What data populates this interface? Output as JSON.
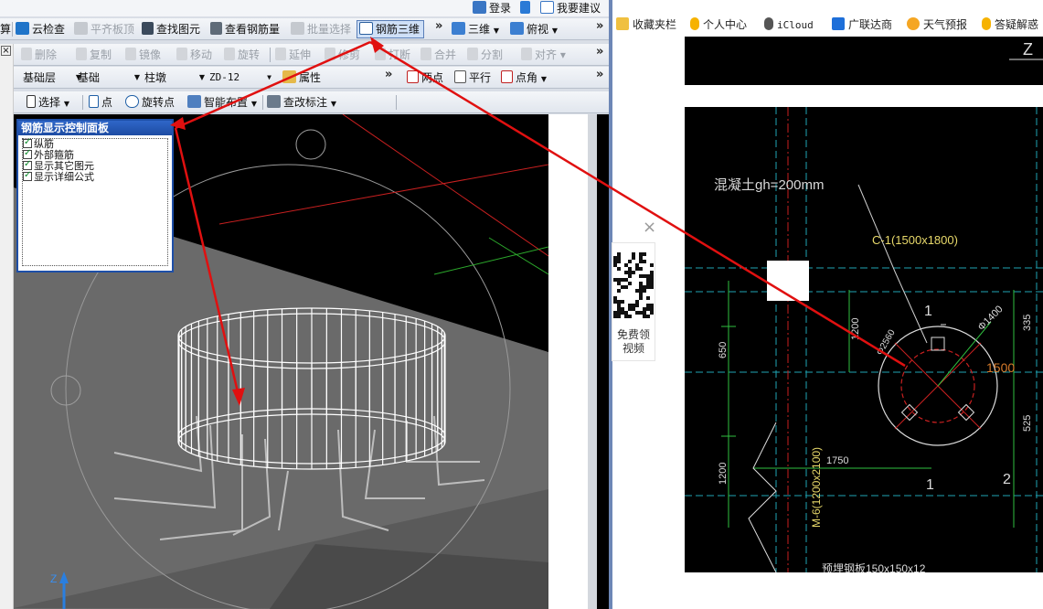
{
  "top_bar": {
    "login": "登录",
    "suggest": "我要建议"
  },
  "toolbar1": {
    "calc_tail": "算",
    "cloud_check": "云检查",
    "flat_top": "平齐板顶",
    "find_elem": "查找图元",
    "view_rebar": "查看钢筋量",
    "batch_select": "批量选择",
    "rebar_3d": "钢筋三维",
    "view_3d": "三维",
    "top_view": "俯视"
  },
  "toolbar2": {
    "delete": "删除",
    "copy": "复制",
    "mirror": "镜像",
    "move": "移动",
    "rotate": "旋转",
    "extend": "延伸",
    "trim": "修剪",
    "break": "打断",
    "merge": "合并",
    "split": "分割",
    "align": "对齐"
  },
  "toolbar3": {
    "layer": "基础层",
    "category": "基础",
    "elem_type": "柱墩",
    "elem_name": "ZD-12",
    "properties": "属性",
    "two_point": "两点",
    "parallel": "平行",
    "point_angle": "点角"
  },
  "toolbar4": {
    "select": "选择",
    "point": "点",
    "rotate_point": "旋转点",
    "smart_layout": "智能布置",
    "edit_label": "查改标注"
  },
  "control_panel": {
    "title": "钢筋显示控制面板",
    "items": [
      {
        "label": "纵筋",
        "checked": true
      },
      {
        "label": "外部箍筋",
        "checked": true
      },
      {
        "label": "显示其它图元",
        "checked": true
      },
      {
        "label": "显示详细公式",
        "checked": true
      }
    ]
  },
  "axis_label": "Z",
  "bookmarks": [
    {
      "label": "收藏夹栏",
      "icon": "folder-icon"
    },
    {
      "label": "个人中心",
      "icon": "glodon-icon"
    },
    {
      "label": "iCloud",
      "icon": "apple-icon"
    },
    {
      "label": "广联达商",
      "icon": "g-icon"
    },
    {
      "label": "天气预报",
      "icon": "weather-icon"
    },
    {
      "label": "答疑解惑",
      "icon": "glodon-icon"
    }
  ],
  "qr_panel": {
    "close": "×",
    "line1": "免费领",
    "line2": "视频"
  },
  "cad_drawing": {
    "concrete": "混凝土gh=200mm",
    "pier_label": "C-1(1500x1800)",
    "section1": "1",
    "section1_bottom": "1",
    "section2": "2",
    "dim_650": "650",
    "dim_1200": "1200",
    "dim_1750": "1750",
    "dim_1200b": "1200",
    "dim_525": "525",
    "dim_1500": "1500",
    "dim_335": "335",
    "diam": "Φ1400",
    "m6": "M-6(1200x2100)",
    "radius": "Φ2560",
    "bottom_note": "预埋钢板150x150x12",
    "z_top": "Z"
  },
  "colors": {
    "accent": "#1e4fa8",
    "arrow": "#e01010",
    "cad_cyan": "#22d3d3",
    "cad_yellow": "#e8d96a",
    "cad_green": "#2fbf3f"
  }
}
